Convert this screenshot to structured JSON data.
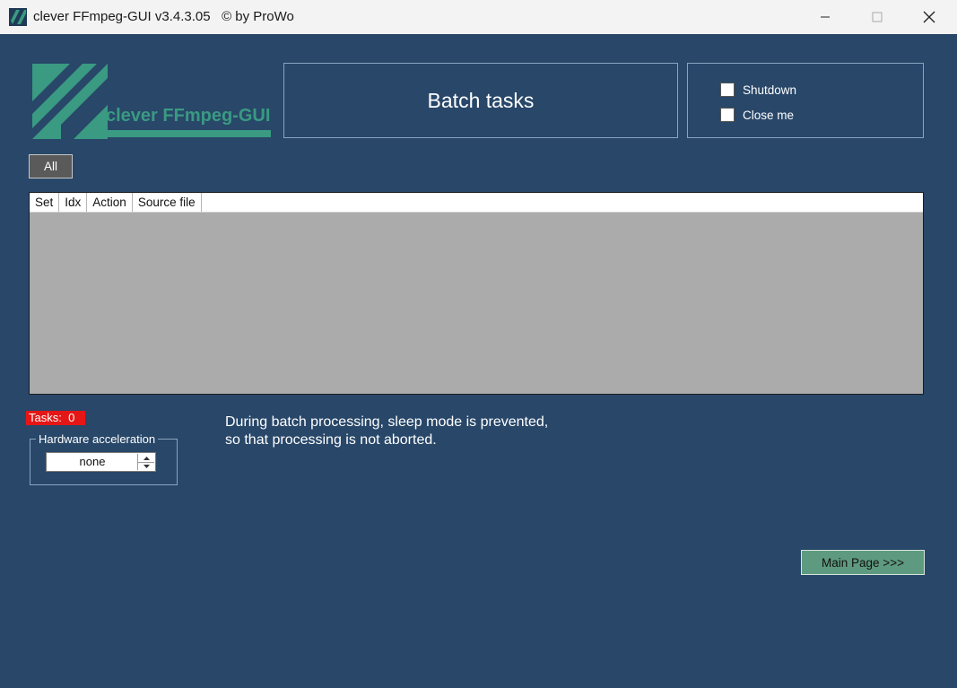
{
  "titlebar": {
    "title": "clever FFmpeg-GUI v3.4.3.05   © by ProWo",
    "minimize_icon": "minimize-icon",
    "maximize_icon": "maximize-icon",
    "close_icon": "close-icon"
  },
  "logo": {
    "text": "clever FFmpeg-GUI"
  },
  "header": {
    "title": "Batch tasks"
  },
  "options": {
    "shutdown_label": "Shutdown",
    "shutdown_checked": false,
    "closeme_label": "Close me",
    "closeme_checked": false
  },
  "filter": {
    "all_label": "All"
  },
  "table": {
    "columns": [
      "Set",
      "Idx",
      "Action",
      "Source file"
    ],
    "rows": []
  },
  "tasks": {
    "label": "Tasks:  0"
  },
  "hardware": {
    "legend": "Hardware acceleration",
    "value": "none"
  },
  "info": {
    "line1": "During batch processing, sleep mode is prevented,",
    "line2": "so that processing is not aborted."
  },
  "nav": {
    "main_page_label": "Main Page >>>"
  },
  "colors": {
    "background": "#284769",
    "accent_green": "#3a9a82",
    "tasks_badge": "#e51616",
    "main_button": "#5e9a7f"
  }
}
